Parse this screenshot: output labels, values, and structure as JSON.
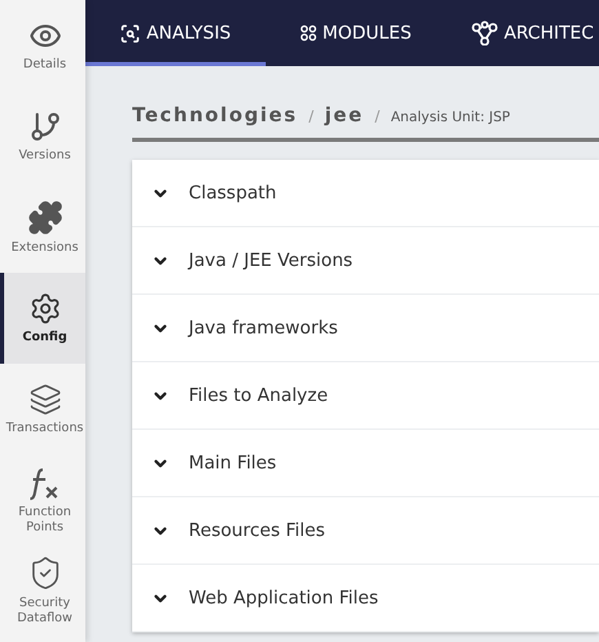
{
  "sidebar": {
    "items": [
      {
        "kind": "eye",
        "label": "Details",
        "selected": false
      },
      {
        "kind": "branch",
        "label": "Versions",
        "selected": false
      },
      {
        "kind": "puzzle",
        "label": "Extensions",
        "selected": false
      },
      {
        "kind": "gear",
        "label": "Config",
        "selected": true
      },
      {
        "kind": "layers",
        "label": "Transactions",
        "selected": false
      },
      {
        "kind": "fx",
        "label": "Function Points",
        "selected": false
      },
      {
        "kind": "shield",
        "label": "Security Dataflow",
        "selected": false
      }
    ]
  },
  "tabs": [
    {
      "kind": "search",
      "label": "ANALYSIS",
      "selected": true
    },
    {
      "kind": "dots",
      "label": "MODULES",
      "selected": false
    },
    {
      "kind": "network",
      "label": "ARCHITEC",
      "selected": false
    }
  ],
  "breadcrumb": {
    "items": [
      "Technologies",
      "jee"
    ],
    "separators": [
      "/",
      "/"
    ],
    "current": "Analysis Unit: JSP"
  },
  "sections": [
    {
      "title": "Classpath",
      "expanded": false
    },
    {
      "title": "Java / JEE Versions",
      "expanded": false
    },
    {
      "title": "Java frameworks",
      "expanded": false
    },
    {
      "title": "Files to Analyze",
      "expanded": false
    },
    {
      "title": "Main Files",
      "expanded": false
    },
    {
      "title": "Resources Files",
      "expanded": false
    },
    {
      "title": "Web Application Files",
      "expanded": false
    }
  ]
}
